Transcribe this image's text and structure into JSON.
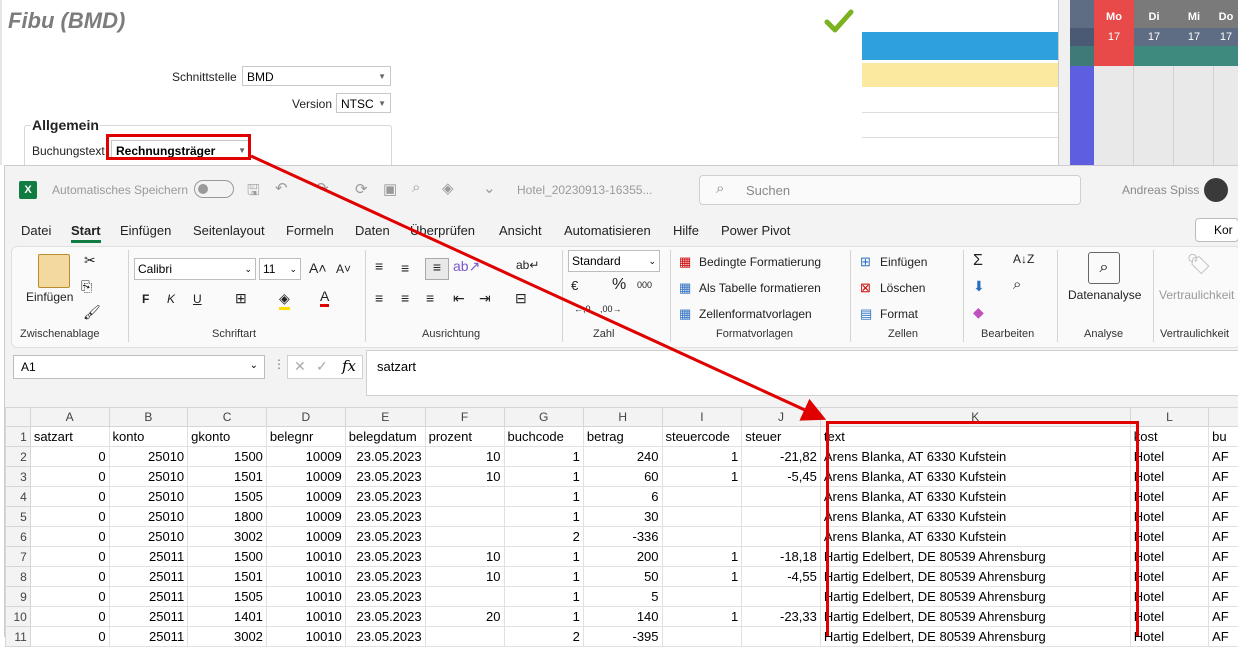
{
  "fibu": {
    "title": "Fibu (BMD)",
    "schnittstelle_label": "Schnittstelle",
    "schnittstelle_value": "BMD",
    "version_label": "Version",
    "version_value": "NTSC",
    "group_title": "Allgemein",
    "buchungstext_label": "Buchungstext",
    "buchungstext_value": "Rechnungsträger"
  },
  "calendar": {
    "days": [
      {
        "day": "Mo",
        "date": "17"
      },
      {
        "day": "Di",
        "date": "17"
      },
      {
        "day": "Mi",
        "date": "17"
      },
      {
        "day": "Do",
        "date": "17"
      }
    ]
  },
  "excel": {
    "autosave_label": "Automatisches Speichern",
    "filename": "Hotel_20230913-16355...",
    "search_placeholder": "Suchen",
    "user_name": "Andreas Spiss",
    "menu": [
      "Datei",
      "Start",
      "Einfügen",
      "Seitenlayout",
      "Formeln",
      "Daten",
      "Überprüfen",
      "Ansicht",
      "Automatisieren",
      "Hilfe",
      "Power Pivot"
    ],
    "active_menu": "Start",
    "kommentar_button": "Kor",
    "ribbon": {
      "paste": "Einfügen",
      "font_name": "Calibri",
      "font_size": "11",
      "bold": "F",
      "italic": "K",
      "underline": "U",
      "number_format": "Standard",
      "bedingte": "Bedingte Formatierung",
      "als_tabelle": "Als Tabelle formatieren",
      "zellformat": "Zellenformatvorlagen",
      "einfuegen": "Einfügen",
      "loeschen": "Löschen",
      "format": "Format",
      "datenanalyse": "Datenanalyse",
      "vertraulichkeit": "Vertraulichkeit",
      "groups": [
        "Zwischenablage",
        "Schriftart",
        "Ausrichtung",
        "Zahl",
        "Formatvorlagen",
        "Zellen",
        "Bearbeiten",
        "Analyse",
        "Vertraulichkeit"
      ]
    },
    "name_box": "A1",
    "formula": "satzart",
    "columns": [
      "A",
      "B",
      "C",
      "D",
      "E",
      "F",
      "G",
      "H",
      "I",
      "J",
      "K",
      "L"
    ],
    "rows": [
      {
        "n": "1",
        "c": [
          "satzart",
          "konto",
          "gkonto",
          "belegnr",
          "belegdatum",
          "prozent",
          "buchcode",
          "betrag",
          "steuercode",
          "steuer",
          "text",
          "kost",
          "bu"
        ]
      },
      {
        "n": "2",
        "c": [
          "0",
          "25010",
          "1500",
          "10009",
          "23.05.2023",
          "10",
          "1",
          "240",
          "1",
          "-21,82",
          "Arens Blanka, AT 6330 Kufstein",
          "Hotel",
          "AF"
        ]
      },
      {
        "n": "3",
        "c": [
          "0",
          "25010",
          "1501",
          "10009",
          "23.05.2023",
          "10",
          "1",
          "60",
          "1",
          "-5,45",
          "Arens Blanka, AT 6330 Kufstein",
          "Hotel",
          "AF"
        ]
      },
      {
        "n": "4",
        "c": [
          "0",
          "25010",
          "1505",
          "10009",
          "23.05.2023",
          "",
          "1",
          "6",
          "",
          "",
          "Arens Blanka, AT 6330 Kufstein",
          "Hotel",
          "AF"
        ]
      },
      {
        "n": "5",
        "c": [
          "0",
          "25010",
          "1800",
          "10009",
          "23.05.2023",
          "",
          "1",
          "30",
          "",
          "",
          "Arens Blanka, AT 6330 Kufstein",
          "Hotel",
          "AF"
        ]
      },
      {
        "n": "6",
        "c": [
          "0",
          "25010",
          "3002",
          "10009",
          "23.05.2023",
          "",
          "2",
          "-336",
          "",
          "",
          "Arens Blanka, AT 6330 Kufstein",
          "Hotel",
          "AF"
        ]
      },
      {
        "n": "7",
        "c": [
          "0",
          "25011",
          "1500",
          "10010",
          "23.05.2023",
          "10",
          "1",
          "200",
          "1",
          "-18,18",
          "Hartig Edelbert, DE 80539 Ahrensburg",
          "Hotel",
          "AF"
        ]
      },
      {
        "n": "8",
        "c": [
          "0",
          "25011",
          "1501",
          "10010",
          "23.05.2023",
          "10",
          "1",
          "50",
          "1",
          "-4,55",
          "Hartig Edelbert, DE 80539 Ahrensburg",
          "Hotel",
          "AF"
        ]
      },
      {
        "n": "9",
        "c": [
          "0",
          "25011",
          "1505",
          "10010",
          "23.05.2023",
          "",
          "1",
          "5",
          "",
          "",
          "Hartig Edelbert, DE 80539 Ahrensburg",
          "Hotel",
          "AF"
        ]
      },
      {
        "n": "10",
        "c": [
          "0",
          "25011",
          "1401",
          "10010",
          "23.05.2023",
          "20",
          "1",
          "140",
          "1",
          "-23,33",
          "Hartig Edelbert, DE 80539 Ahrensburg",
          "Hotel",
          "AF"
        ]
      },
      {
        "n": "11",
        "c": [
          "0",
          "25011",
          "3002",
          "10010",
          "23.05.2023",
          "",
          "2",
          "-395",
          "",
          "",
          "Hartig Edelbert, DE 80539 Ahrensburg",
          "Hotel",
          "AF"
        ]
      }
    ]
  },
  "colors": {
    "highlight_red": "#e00000",
    "excel_green": "#107c41",
    "cal_red": "#e84a4a",
    "cal_blue": "#2ea0db",
    "cal_yellow": "#fbe9a0",
    "cal_teal": "#3f8a7e",
    "cal_purple": "#6a5acd"
  }
}
